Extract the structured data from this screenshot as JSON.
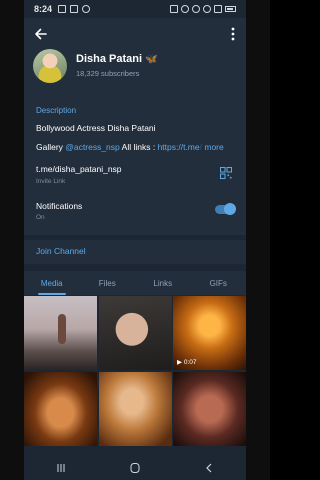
{
  "status_bar": {
    "time": "8:24"
  },
  "header": {
    "name": "Disha Patani",
    "name_badge": "🦋",
    "subscribers": "18,329 subscribers"
  },
  "info": {
    "section_title": "Description",
    "bio": "Bollywood Actress Disha Patani",
    "gallery_prefix": "Gallery ",
    "gallery_handle": "@actress_nsp",
    "gallery_mid": "  All links : ",
    "gallery_link": "https://t.me",
    "gallery_link_fade": "/",
    "more_label": "more",
    "invite_link": "t.me/disha_patani_nsp",
    "invite_sub": "Invite Link",
    "notifications_label": "Notifications",
    "notifications_state": "On"
  },
  "join": {
    "label": "Join Channel"
  },
  "tabs": [
    {
      "label": "Media",
      "active": true
    },
    {
      "label": "Files",
      "active": false
    },
    {
      "label": "Links",
      "active": false
    },
    {
      "label": "GIFs",
      "active": false
    }
  ],
  "media": [
    {
      "duration": ""
    },
    {
      "duration": ""
    },
    {
      "duration": "0:07"
    },
    {
      "duration": ""
    },
    {
      "duration": ""
    },
    {
      "duration": ""
    }
  ],
  "colors": {
    "accent": "#5ea9e5",
    "background": "#1d2733",
    "panel": "#232e3c"
  }
}
